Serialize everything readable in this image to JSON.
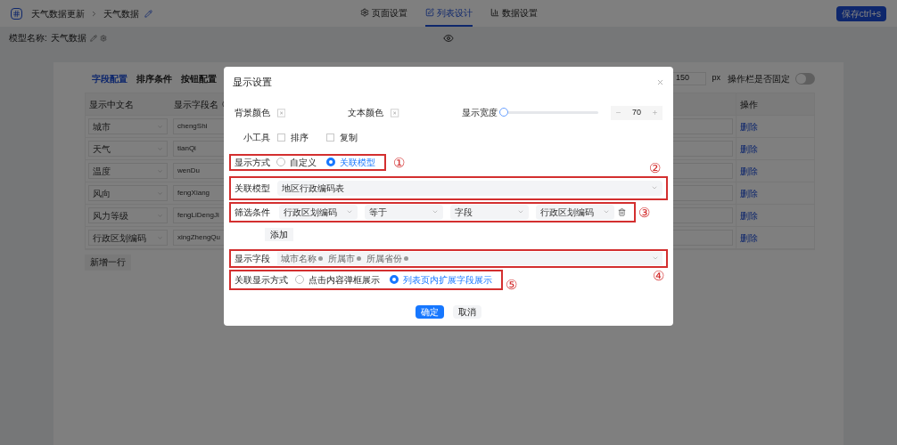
{
  "header": {
    "breadcrumb": [
      "天气数据更新",
      "天气数据"
    ],
    "tabs": [
      {
        "label": "页面设置",
        "kind": "page",
        "selected": false
      },
      {
        "label": "列表设计",
        "kind": "list",
        "selected": true
      },
      {
        "label": "数据设置",
        "kind": "data",
        "selected": false
      }
    ],
    "save_button": "保存ctrl+s"
  },
  "model_name": {
    "label": "模型名称:",
    "value": "天气数据"
  },
  "config_tabs": [
    {
      "label": "字段配置",
      "selected": true
    },
    {
      "label": "排序条件",
      "selected": false
    },
    {
      "label": "按钮配置",
      "selected": false
    }
  ],
  "width_input": {
    "value": "150",
    "unit": "px"
  },
  "fixed_toggle": {
    "label": "操作栏是否固定",
    "on": false
  },
  "table": {
    "columns": [
      "显示中文名",
      "显示字段名",
      "操作"
    ],
    "rows": [
      {
        "name": "城市",
        "field": "chengShi",
        "action": "删除"
      },
      {
        "name": "天气",
        "field": "tianQi",
        "action": "删除"
      },
      {
        "name": "温度",
        "field": "wenDu",
        "action": "删除"
      },
      {
        "name": "风向",
        "field": "fengXiang",
        "action": "删除"
      },
      {
        "name": "风力等级",
        "field": "fengLiDengJi",
        "action": "删除"
      },
      {
        "name": "行政区划编码",
        "field": "xingZhengQu",
        "action": "删除"
      }
    ]
  },
  "add_row": "新增一行",
  "dialog": {
    "title": "显示设置",
    "bg_color_label": "背景颜色",
    "text_color_label": "文本颜色",
    "width": {
      "label": "显示宽度",
      "level": 0,
      "value": "70"
    },
    "tools": {
      "label": "小工具",
      "options": [
        {
          "label": "排序",
          "checked": false
        },
        {
          "label": "复制",
          "checked": false
        }
      ]
    },
    "display_mode": {
      "label": "显示方式",
      "annotation": "①",
      "options": [
        {
          "label": "自定义",
          "selected": false
        },
        {
          "label": "关联模型",
          "selected": true
        }
      ]
    },
    "related_model": {
      "label": "关联模型",
      "value": "地区行政编码表",
      "annotation": "②"
    },
    "filter": {
      "label": "筛选条件",
      "annotation": "③",
      "selects": [
        "行政区划编码",
        "等于",
        "字段",
        "行政区划编码"
      ],
      "add_button": "添加"
    },
    "display_fields": {
      "label": "显示字段",
      "annotation": "④",
      "tags": [
        "城市名称",
        "所属市",
        "所属省份"
      ]
    },
    "related_display": {
      "label": "关联显示方式",
      "annotation": "⑤",
      "options": [
        {
          "label": "点击内容弹框展示",
          "selected": false
        },
        {
          "label": "列表页内扩展字段展示",
          "selected": true
        }
      ]
    },
    "buttons": [
      {
        "label": "确定",
        "kind": "primary"
      },
      {
        "label": "取消",
        "kind": "default"
      }
    ]
  }
}
